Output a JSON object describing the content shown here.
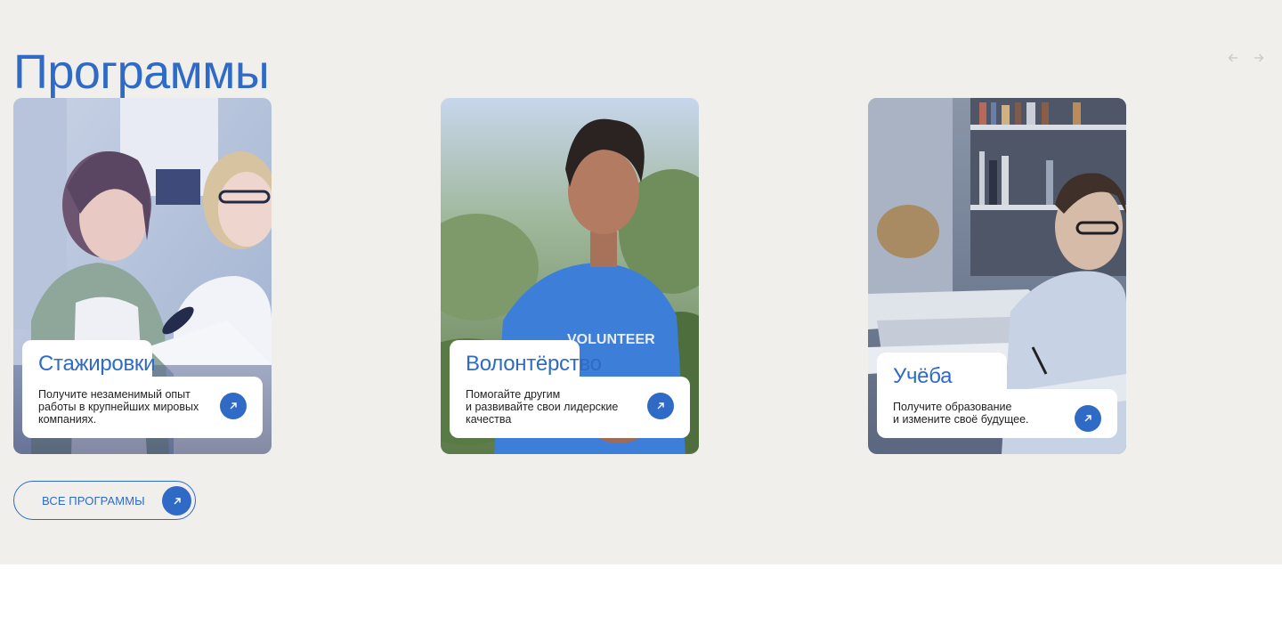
{
  "section": {
    "title": "Программы",
    "nav": {
      "prev_icon": "arrow-left-icon",
      "next_icon": "arrow-right-icon"
    },
    "all_button": {
      "label": "ВСЕ ПРОГРАММЫ",
      "icon": "arrow-up-right-icon"
    }
  },
  "cards": [
    {
      "title": "Стажировки",
      "description": "Получите незаменимый опыт\nработы в крупнейших мировых\nкомпаниях.",
      "photo": "two-women-working-photo",
      "button_icon": "arrow-up-right-icon"
    },
    {
      "title": "Волонтёрство",
      "description": "Помогайте другим\nи развивайте свои лидерские\nкачества",
      "photo": "volunteer-young-man-photo",
      "photo_text": "VOLUNTEER",
      "button_icon": "arrow-up-right-icon"
    },
    {
      "title": "Учёба",
      "description": "Получите образование\nи измените своё будущее.",
      "photo": "student-studying-library-photo",
      "button_icon": "arrow-up-right-icon"
    }
  ],
  "colors": {
    "accent": "#2f6bc6",
    "section_bg": "#f0efeb",
    "page_bg": "#ffffff",
    "text_dark": "#222222",
    "nav_arrow": "#c9c8c4"
  }
}
